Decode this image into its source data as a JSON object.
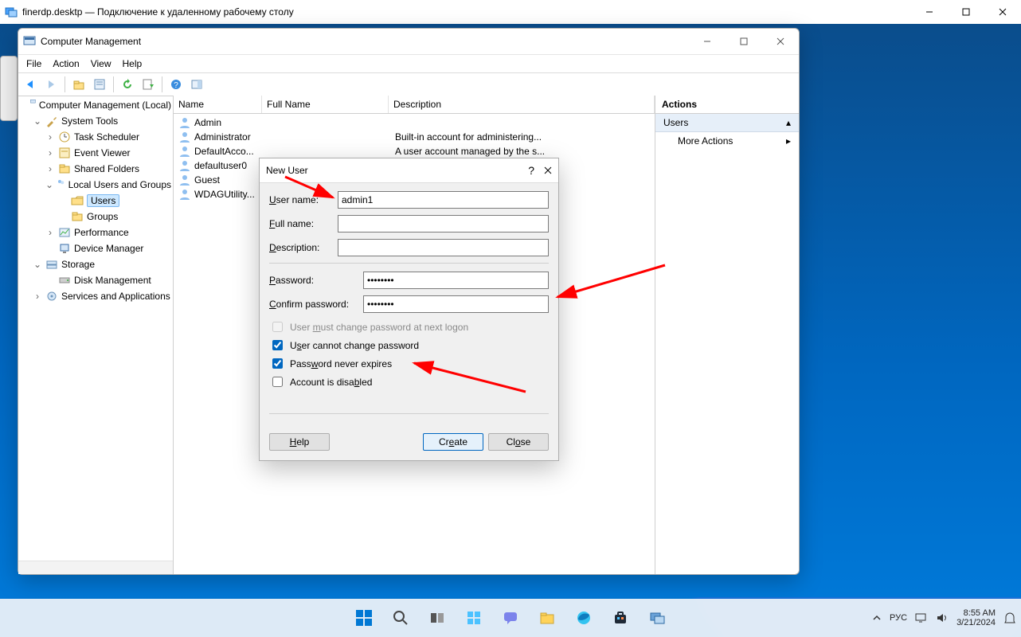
{
  "rdp": {
    "title": "finerdp.desktp — Подключение к удаленному рабочему столу"
  },
  "cm": {
    "title": "Computer Management",
    "menu": {
      "file": "File",
      "action": "Action",
      "view": "View",
      "help": "Help"
    },
    "tree": {
      "root": "Computer Management (Local)",
      "system_tools": "System Tools",
      "task_scheduler": "Task Scheduler",
      "event_viewer": "Event Viewer",
      "shared_folders": "Shared Folders",
      "local_users": "Local Users and Groups",
      "users": "Users",
      "groups": "Groups",
      "performance": "Performance",
      "device_manager": "Device Manager",
      "storage": "Storage",
      "disk_management": "Disk Management",
      "services": "Services and Applications"
    },
    "columns": {
      "name": "Name",
      "full_name": "Full Name",
      "description": "Description"
    },
    "users": [
      {
        "name": "Admin",
        "full": "",
        "desc": ""
      },
      {
        "name": "Administrator",
        "full": "",
        "desc": "Built-in account for administering..."
      },
      {
        "name": "DefaultAcco...",
        "full": "",
        "desc": "A user account managed by the s..."
      },
      {
        "name": "defaultuser0",
        "full": "",
        "desc": ""
      },
      {
        "name": "Guest",
        "full": "",
        "desc": ""
      },
      {
        "name": "WDAGUtility...",
        "full": "",
        "desc": ""
      }
    ],
    "actions": {
      "header": "Actions",
      "category": "Users",
      "more": "More Actions"
    }
  },
  "dialog": {
    "title": "New User",
    "labels": {
      "username": "User name:",
      "fullname": "Full name:",
      "description": "Description:",
      "password": "Password:",
      "confirm": "Confirm password:"
    },
    "values": {
      "username": "admin1",
      "password": "••••••••",
      "confirm": "••••••••"
    },
    "checks": {
      "must_change": "User must change password at next logon",
      "cannot_change": "User cannot change password",
      "never_expires": "Password never expires",
      "disabled": "Account is disabled"
    },
    "buttons": {
      "help": "Help",
      "create": "Create",
      "close": "Close"
    }
  },
  "tray": {
    "lang": "РУС",
    "time": "8:55 AM",
    "date": "3/21/2024"
  }
}
